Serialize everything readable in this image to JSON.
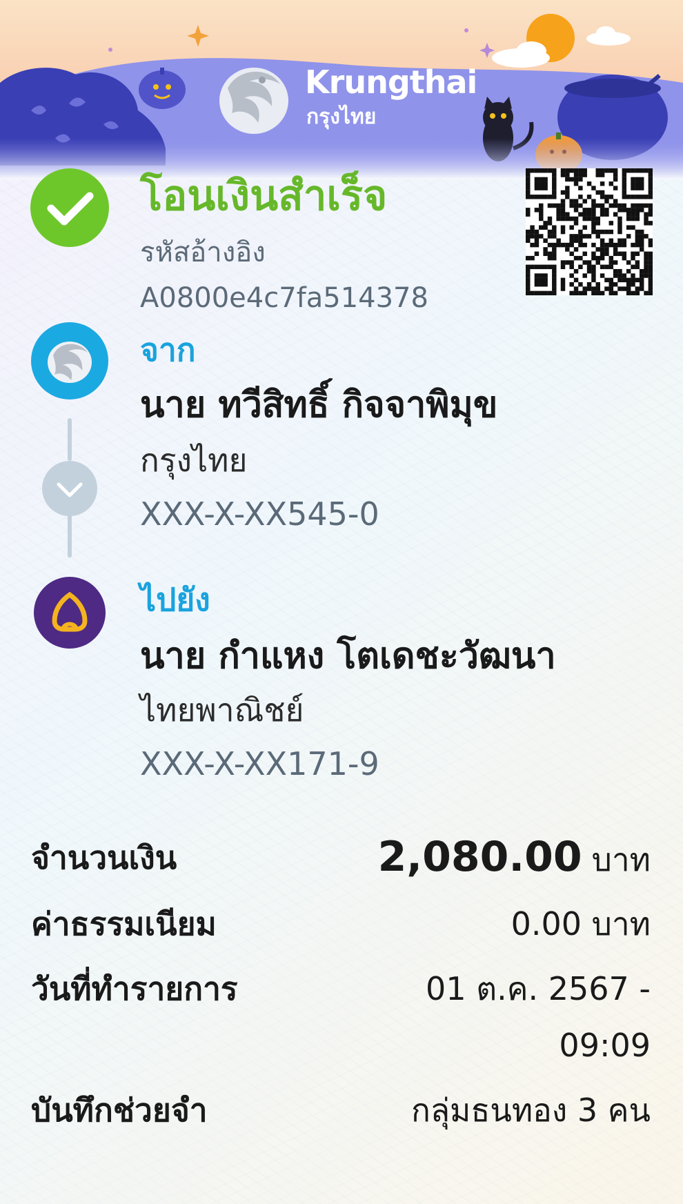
{
  "header": {
    "brand_en": "Krungthai",
    "brand_th": "กรุงไทย"
  },
  "status": {
    "title": "โอนเงินสำเร็จ",
    "ref_label": "รหัสอ้างอิง",
    "ref_value": "A0800e4c7fa514378",
    "icon": "check-icon",
    "color": "#6ec72a"
  },
  "from": {
    "label": "จาก",
    "name": "นาย ทวีสิทธิ์ กิจจาพิมุข",
    "bank": "กรุงไทย",
    "account": "XXX-X-XX545-0",
    "icon": "krungthai-bank-icon",
    "color": "#1ba9e1"
  },
  "to": {
    "label": "ไปยัง",
    "name": "นาย กำแหง โตเดชะวัฒนา",
    "bank": "ไทยพาณิชย์",
    "account": "XXX-X-XX171-9",
    "icon": "scb-bank-icon",
    "color": "#4e2a84"
  },
  "details": {
    "amount_label": "จำนวนเงิน",
    "amount_value": "2,080.00",
    "amount_unit": "บาท",
    "fee_label": "ค่าธรรมเนียม",
    "fee_value": "0.00 บาท",
    "date_label": "วันที่ทำรายการ",
    "date_line1": "01 ต.ค. 2567 -",
    "date_line2": "09:09",
    "memo_label": "บันทึกช่วยจำ",
    "memo_value": "กลุ่มธนทอง 3 คน"
  },
  "colors": {
    "success": "#66b82a",
    "accent": "#1aa3dd",
    "muted": "#5b6a78"
  }
}
